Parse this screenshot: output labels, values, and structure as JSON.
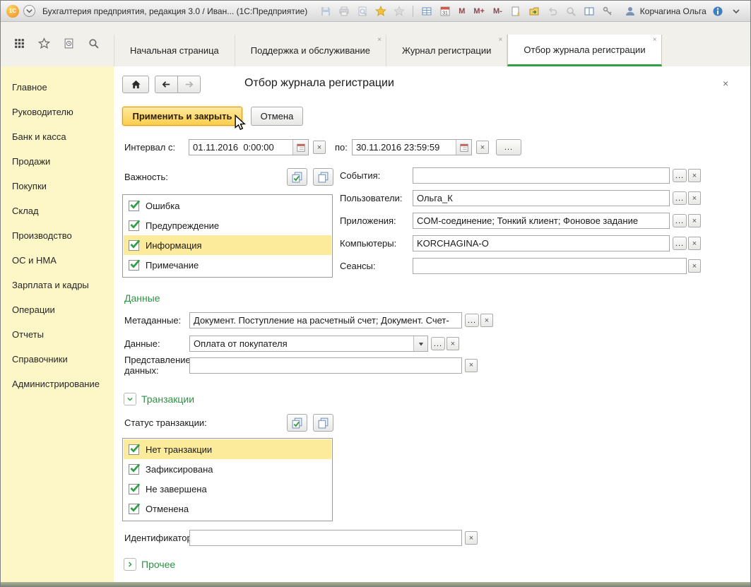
{
  "titlebar": {
    "logo_text": "1С",
    "title": "Бухгалтерия предприятия, редакция 3.0 / Иван... (1С:Предприятие)",
    "memory_buttons": [
      "M",
      "M+",
      "M-"
    ],
    "calendar_day": "31",
    "user_name": "Корчагина Ольга",
    "controls": {
      "minimize": "—",
      "maximize": "❐",
      "close": "×"
    }
  },
  "tabbar": {
    "tabs": [
      "Начальная страница",
      "Поддержка и обслуживание",
      "Журнал регистрации",
      "Отбор журнала регистрации"
    ],
    "close_glyph": "×"
  },
  "sidebar": {
    "items": [
      "Главное",
      "Руководителю",
      "Банк и касса",
      "Продажи",
      "Покупки",
      "Склад",
      "Производство",
      "ОС и НМА",
      "Зарплата и кадры",
      "Операции",
      "Отчеты",
      "Справочники",
      "Администрирование"
    ]
  },
  "form": {
    "title": "Отбор журнала регистрации",
    "close_glyph": "×",
    "apply_label": "Применить и закрыть",
    "cancel_label": "Отмена",
    "interval_label": "Интервал с:",
    "interval_from": "01.11.2016  0:00:00",
    "interval_to_label": "по:",
    "interval_to": "30.11.2016 23:59:59",
    "interval_more": "...",
    "importance_label": "Важность:",
    "importance_items": [
      "Ошибка",
      "Предупреждение",
      "Информация",
      "Примечание"
    ],
    "events_label": "События:",
    "events_value": "",
    "users_label": "Пользователи:",
    "users_value": "Ольга_К",
    "apps_label": "Приложения:",
    "apps_value": "COM-соединение; Тонкий клиент; Фоновое задание",
    "computers_label": "Компьютеры:",
    "computers_value": "KORCHAGINA-O",
    "sessions_label": "Сеансы:",
    "sessions_value": "",
    "data_section_title": "Данные",
    "metadata_label": "Метаданные:",
    "metadata_value": "Документ. Поступление на расчетный счет; Документ. Счет-",
    "data_label": "Данные:",
    "data_value": "Оплата от покупателя",
    "presentation_label": "Представление данных:",
    "presentation_value": "",
    "transactions_title": "Транзакции",
    "tx_status_label": "Статус транзакции:",
    "tx_items": [
      "Нет транзакции",
      "Зафиксирована",
      "Не завершена",
      "Отменена"
    ],
    "identifier_label": "Идентификатор:",
    "identifier_value": "",
    "other_title": "Прочее",
    "ellipsis": "...",
    "clear_glyph": "×"
  }
}
